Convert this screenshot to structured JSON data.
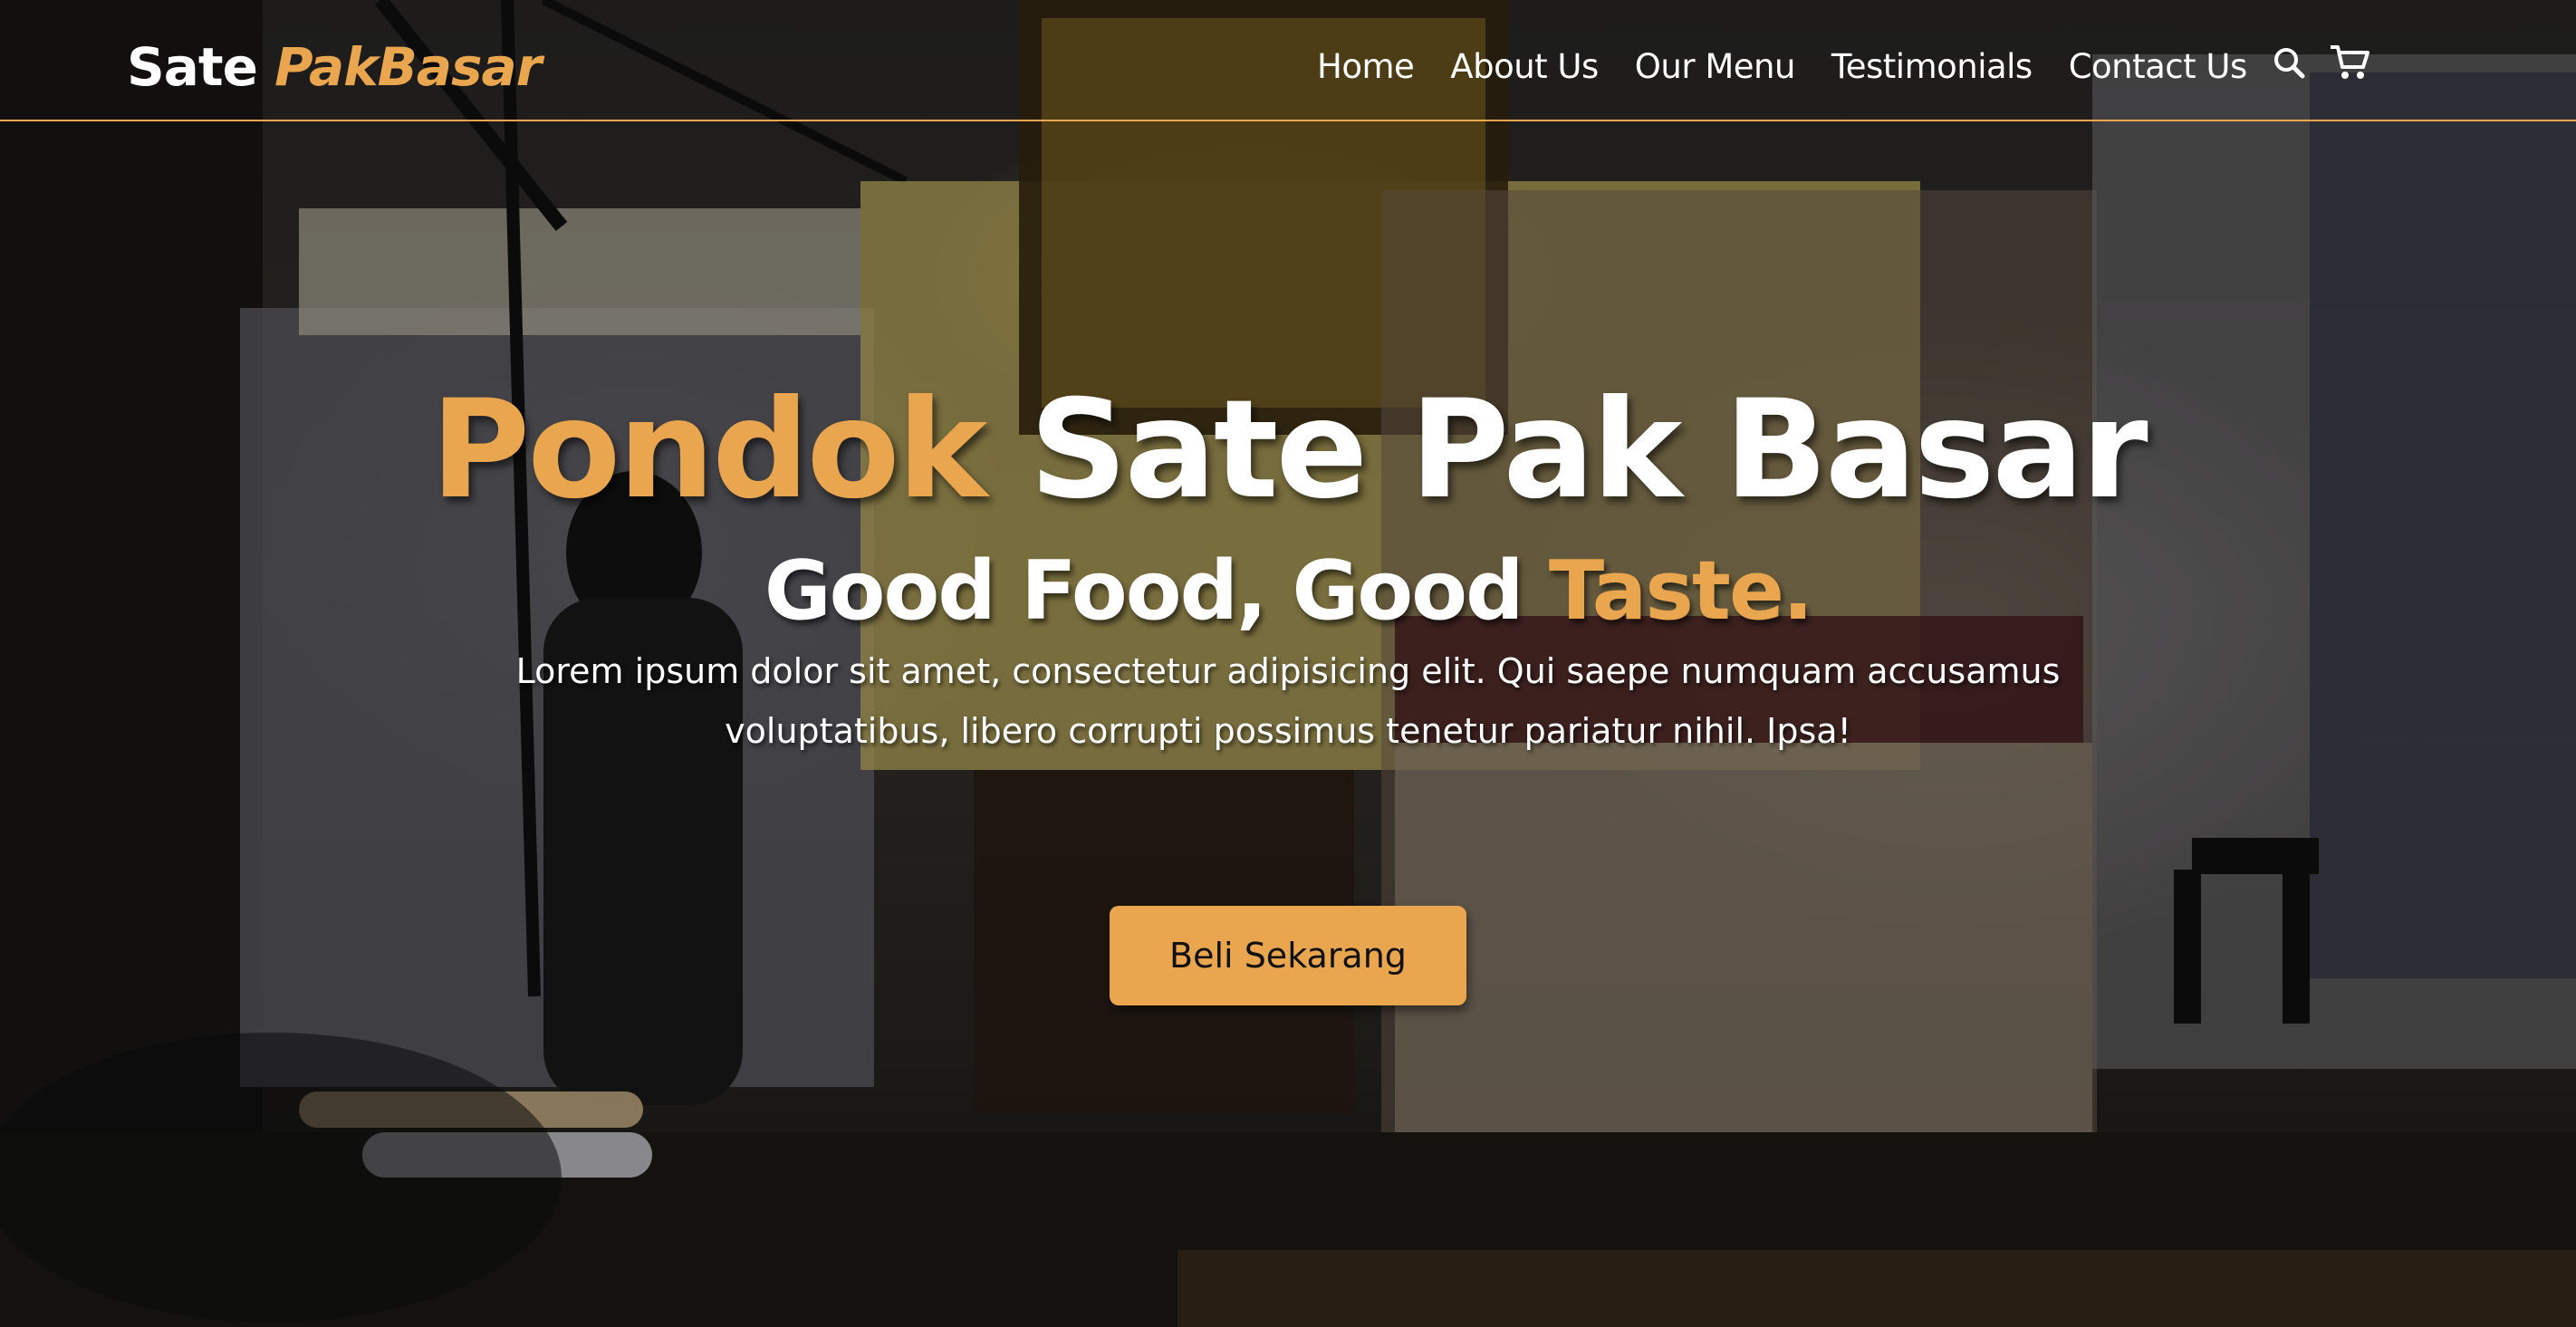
{
  "navbar": {
    "logo": {
      "primary": "Sate ",
      "accent": "PakBasar"
    },
    "links": [
      "Home",
      "About Us",
      "Our Menu",
      "Testimonials",
      "Contact Us"
    ],
    "icons": [
      "search-icon",
      "cart-icon"
    ]
  },
  "hero": {
    "title": {
      "accent": "Pondok",
      "rest": " Sate Pak Basar"
    },
    "tagline": {
      "primary": "Good Food, Good ",
      "accent": "Taste."
    },
    "description": "Lorem ipsum dolor sit amet, consectetur adipisicing elit. Qui saepe numquam accusamus voluptatibus, libero corrupti possimus tenetur pariatur nihil. Ipsa!",
    "cta_label": "Beli Sekarang"
  },
  "colors": {
    "accent": "#e9a64f",
    "text": "#ffffff",
    "button_text": "#111111"
  }
}
